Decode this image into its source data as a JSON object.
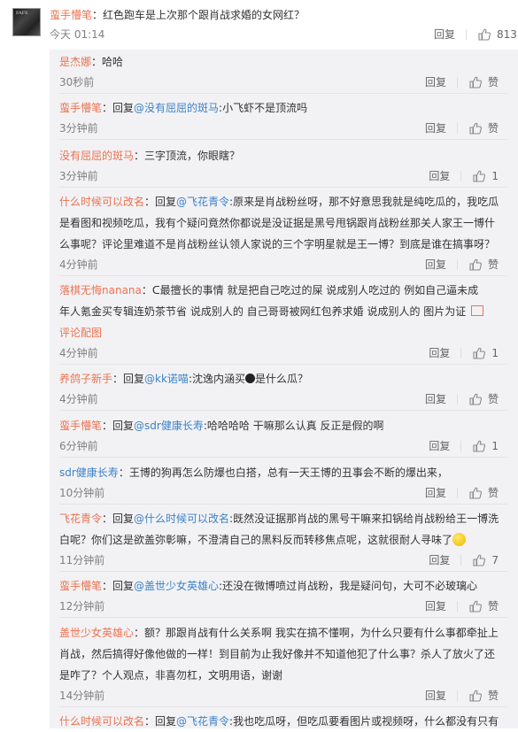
{
  "top_comment": {
    "avatar_text": "FAFE",
    "user": "蛮手懵笔",
    "text": "：红色跑车是上次那个跟肖战求婚的女网红？",
    "time": "今天 01:14",
    "reply_label": "回复",
    "likes": "813"
  },
  "replies": [
    {
      "user": "是杰娜",
      "text": "：哈哈",
      "time": "30秒前",
      "reply_label": "回复",
      "like": "赞"
    },
    {
      "user": "蛮手懵笔",
      "prefix": "：回复",
      "mention": "@没有屈屈的斑马",
      "text": ":小飞虾不是顶流吗",
      "time": "3分钟前",
      "reply_label": "回复",
      "like": "赞"
    },
    {
      "user": "没有屈屈的斑马",
      "text": "：三字顶流，你眼瞎？",
      "time": "3分钟前",
      "reply_label": "回复",
      "like": "1"
    },
    {
      "user": "什么时候可以改名",
      "prefix": "：回复",
      "mention": "@飞花青令",
      "text_line1": ":原来是肖战粉丝呀，那不好意思我就是纯吃瓜的，我吃瓜",
      "text_line2": "是看图和视频吃瓜，我有个疑问竟然你都说是没证据是黑号甩锅跟肖战粉丝那关人家王一博什",
      "text_line3": "么事呢？评论里难道不是肖战粉丝认领人家说的三个字明星就是王一博？到底是谁在搞事呀？",
      "time": "4分钟前",
      "reply_label": "回复",
      "like": "赞"
    },
    {
      "user": "落棋无悔nanana",
      "text_line1": "：ᑕ最擅长的事情 就是把自己吃过的屎 说成别人吃过的 例如自己逼未成",
      "text_line2": "年人氪金买专辑连奶茶节省 说成别人的 自己哥哥被网红包养求婚 说成别人的 图片为证",
      "img_label": "评论配图",
      "time": "4分钟前",
      "reply_label": "回复",
      "like": "1"
    },
    {
      "user": "养鸽子新手",
      "prefix": "：回复",
      "mention": "@kk诺喵",
      "text": ":沈逸内涵买",
      "text_after": "是什么瓜？",
      "time": "4分钟前",
      "reply_label": "回复",
      "like": "赞"
    },
    {
      "user": "蛮手懵笔",
      "prefix": "：回复",
      "mention": "@sdr健康长寿",
      "text": ":哈哈哈哈 干嘛那么认真 反正是假的啊",
      "time": "6分钟前",
      "reply_label": "回复",
      "like": "1"
    },
    {
      "user": "sdr健康长寿",
      "text": "：王博的狗再怎么防爆也白搭，总有一天王博的丑事会不断的爆出来，",
      "time": "10分钟前",
      "reply_label": "回复",
      "like": "赞"
    },
    {
      "user": "飞花青令",
      "prefix": "：回复",
      "mention": "@什么时候可以改名",
      "text_line1": ":既然没证据那肖战的黑号干嘛来扣锅给肖战粉给王一博洗",
      "text_line2": "白呢？你们这是欲盖弥彰嘛，不澄清自己的黑料反而转移焦点呢，这就很耐人寻味了",
      "time": "11分钟前",
      "reply_label": "回复",
      "like": "7"
    },
    {
      "user": "蛮手懵笔",
      "prefix": "：回复",
      "mention": "@盖世少女英雄心",
      "text": ":还没在微博喷过肖战粉，我是疑问句，大可不必玻璃心",
      "time": "12分钟前",
      "reply_label": "回复",
      "like": "赞"
    },
    {
      "user": "盖世少女英雄心",
      "text_line1": "：额？那跟肖战有什么关系啊 我实在搞不懂啊，为什么只要有什么事都牵扯上",
      "text_line2": "肖战，然后搞得好像他做的一样！到目前为止我好像并不知道他犯了什么事？杀人了放火了还",
      "text_line3": "是咋了？个人观点，非喜勿杠，文明用语，谢谢",
      "time": "14分钟前",
      "reply_label": "回复",
      "like": "赞"
    },
    {
      "user": "什么时候可以改名",
      "prefix": "：回复",
      "mention": "@飞花青令",
      "text": ":我也吃瓜呀，但吃瓜要看图片或视频呀，什么都没有只有"
    }
  ]
}
